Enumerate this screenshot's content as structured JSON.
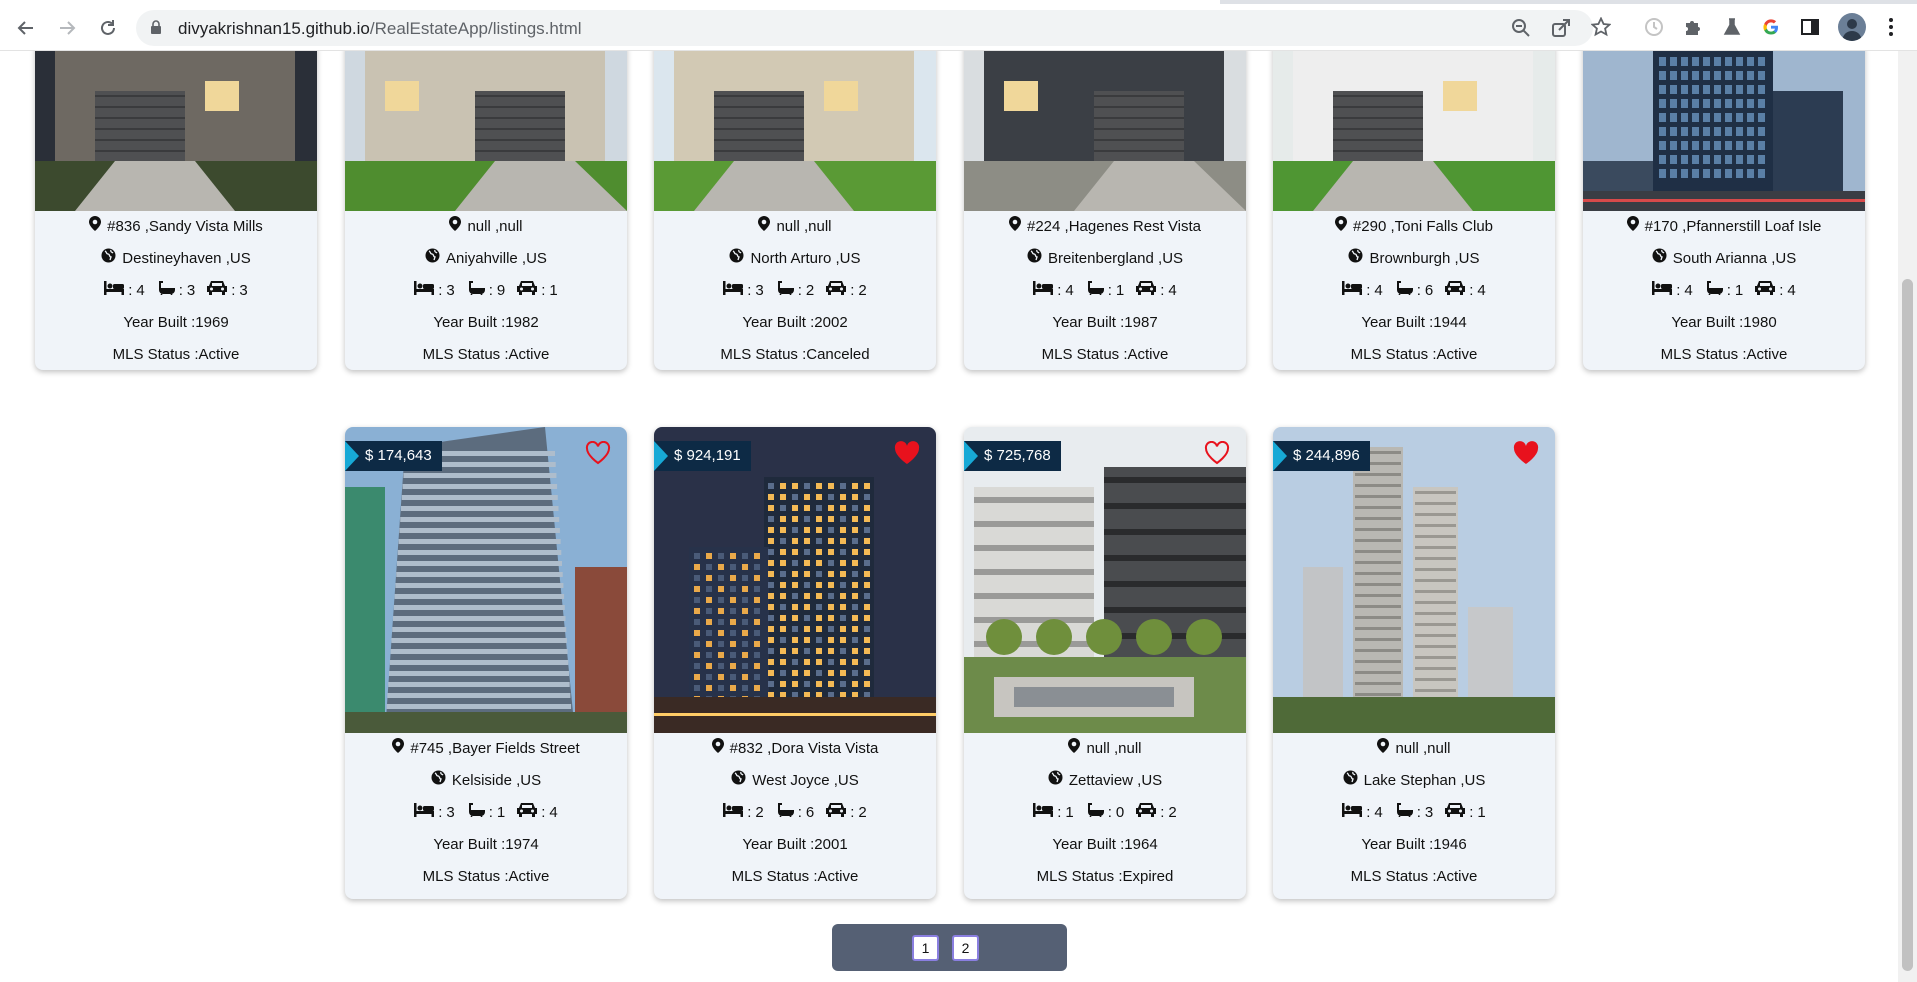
{
  "browser": {
    "url_host": "divyakrishnan15.github.io",
    "url_path": "/RealEstateApp/listings.html"
  },
  "top_row": [
    {
      "address": "#836 ,Sandy Vista Mills",
      "city": "Destineyhaven ,US",
      "beds": "4",
      "baths": "3",
      "cars": "3",
      "year": "Year Built :1969",
      "status": "MLS Status :Active"
    },
    {
      "address": "null ,null",
      "city": "Aniyahville ,US",
      "beds": "3",
      "baths": "9",
      "cars": "1",
      "year": "Year Built :1982",
      "status": "MLS Status :Active"
    },
    {
      "address": "null ,null",
      "city": "North Arturo ,US",
      "beds": "3",
      "baths": "2",
      "cars": "2",
      "year": "Year Built :2002",
      "status": "MLS Status :Canceled"
    },
    {
      "address": "#224 ,Hagenes Rest Vista",
      "city": "Breitenbergland ,US",
      "beds": "4",
      "baths": "1",
      "cars": "4",
      "year": "Year Built :1987",
      "status": "MLS Status :Active"
    },
    {
      "address": "#290 ,Toni Falls Club",
      "city": "Brownburgh ,US",
      "beds": "4",
      "baths": "6",
      "cars": "4",
      "year": "Year Built :1944",
      "status": "MLS Status :Active"
    },
    {
      "address": "#170 ,Pfannerstill Loaf Isle",
      "city": "South Arianna ,US",
      "beds": "4",
      "baths": "1",
      "cars": "4",
      "year": "Year Built :1980",
      "status": "MLS Status :Active"
    }
  ],
  "bottom_row": [
    {
      "price": "$ 174,643",
      "favorited": false,
      "address": "#745 ,Bayer Fields Street",
      "city": "Kelsiside ,US",
      "beds": "3",
      "baths": "1",
      "cars": "4",
      "year": "Year Built :1974",
      "status": "MLS Status :Active"
    },
    {
      "price": "$ 924,191",
      "favorited": true,
      "address": "#832 ,Dora Vista Vista",
      "city": "West Joyce ,US",
      "beds": "2",
      "baths": "6",
      "cars": "2",
      "year": "Year Built :2001",
      "status": "MLS Status :Active"
    },
    {
      "price": "$ 725,768",
      "favorited": false,
      "address": "null ,null",
      "city": "Zettaview ,US",
      "beds": "1",
      "baths": "0",
      "cars": "2",
      "year": "Year Built :1964",
      "status": "MLS Status :Expired"
    },
    {
      "price": "$ 244,896",
      "favorited": true,
      "address": "null ,null",
      "city": "Lake Stephan ,US",
      "beds": "4",
      "baths": "3",
      "cars": "1",
      "year": "Year Built :1946",
      "status": "MLS Status :Active"
    }
  ],
  "feature_sep": ":",
  "pagination": [
    "1",
    "2"
  ],
  "colors": {
    "accent_flag": "#17a9d6",
    "price_bg": "#0d2a45",
    "heart": "#e8121d",
    "card_bg": "#f0f4f9",
    "pager_bg": "#556074"
  }
}
